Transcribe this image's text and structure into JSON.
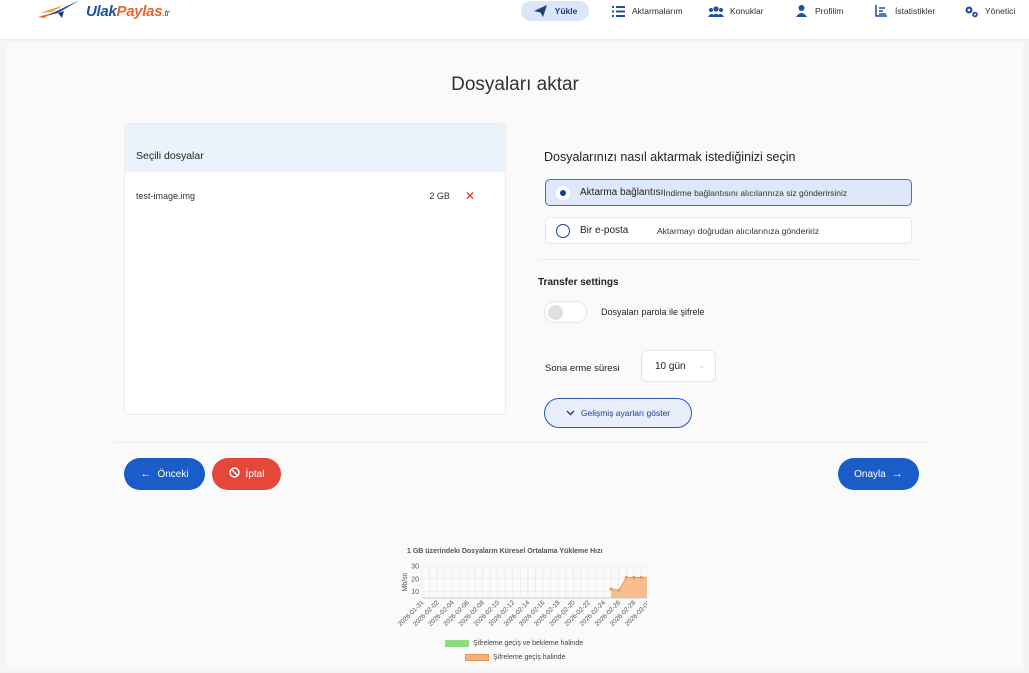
{
  "brand": {
    "name_part1": "Ulak",
    "name_part2": "Paylas",
    "tld": ".tr"
  },
  "nav": {
    "items": [
      {
        "label": "Yükle",
        "icon": "paper-plane-icon"
      },
      {
        "label": "Aktarmalarım",
        "icon": "list-icon"
      },
      {
        "label": "Konuklar",
        "icon": "users-icon"
      },
      {
        "label": "Profilim",
        "icon": "user-icon"
      },
      {
        "label": "İstatistikler",
        "icon": "stats-icon"
      },
      {
        "label": "Yönetici",
        "icon": "gears-icon"
      }
    ]
  },
  "page": {
    "title": "Dosyaları aktar"
  },
  "files": {
    "header": "Seçili dosyalar",
    "items": [
      {
        "name": "test-image.img",
        "size": "2 GB",
        "remove": "✕"
      }
    ]
  },
  "transfer": {
    "question": "Dosyalarınızı nasıl aktarmak istediğinizi seçin",
    "options": [
      {
        "label": "Aktarma bağlantısı",
        "desc": "İndirme bağlantısını alıcılarınıza siz gönderirsiniz",
        "selected": true
      },
      {
        "label": "Bir e-posta",
        "desc": "Aktarmayı doğrudan alıcılarınıza göndeririz",
        "selected": false
      }
    ]
  },
  "settings": {
    "title": "Transfer settings",
    "encrypt_label": "Dosyaları parola ile şifrele",
    "encrypt_on": false,
    "expiry_label": "Sona erme süresi",
    "expiry_value": "10 gün",
    "advanced_label": "Gelişmiş ayarları göster"
  },
  "actions": {
    "prev": "Önceki",
    "cancel": "İptal",
    "next": "Onayla"
  },
  "colors": {
    "primary": "#1a5dc9",
    "danger": "#e5483a",
    "selected_bg": "#dfe8f8",
    "legend_green": "#8fdc7e",
    "legend_orange": "#f5b27a"
  },
  "chart_data": {
    "type": "area",
    "title": "1 GB üzerindeki Dosyaların Küresel Ortalama Yükleme Hızı",
    "ylabel": "Mb/sn",
    "ylim": [
      5,
      30
    ],
    "yticks": [
      10,
      20,
      30
    ],
    "x": [
      "2026-01-31",
      "2026-02-02",
      "2026-02-04",
      "2026-02-06",
      "2026-02-08",
      "2026-02-10",
      "2026-02-12",
      "2026-02-14",
      "2026-02-16",
      "2026-02-18",
      "2026-02-20",
      "2026-02-22",
      "2026-02-24",
      "2026-02-26",
      "2026-02-28",
      "2026-03-02"
    ],
    "series": [
      {
        "name": "Şifreleme geçiş ve bekleme halinde",
        "values": []
      },
      {
        "name": "Şifreleme geçiş halinde",
        "points": [
          [
            "2026-02-25",
            12
          ],
          [
            "2026-02-26",
            11
          ],
          [
            "2026-02-27",
            21
          ],
          [
            "2026-02-28",
            21
          ],
          [
            "2026-03-01",
            21
          ],
          [
            "2026-03-02",
            21
          ]
        ]
      }
    ]
  }
}
